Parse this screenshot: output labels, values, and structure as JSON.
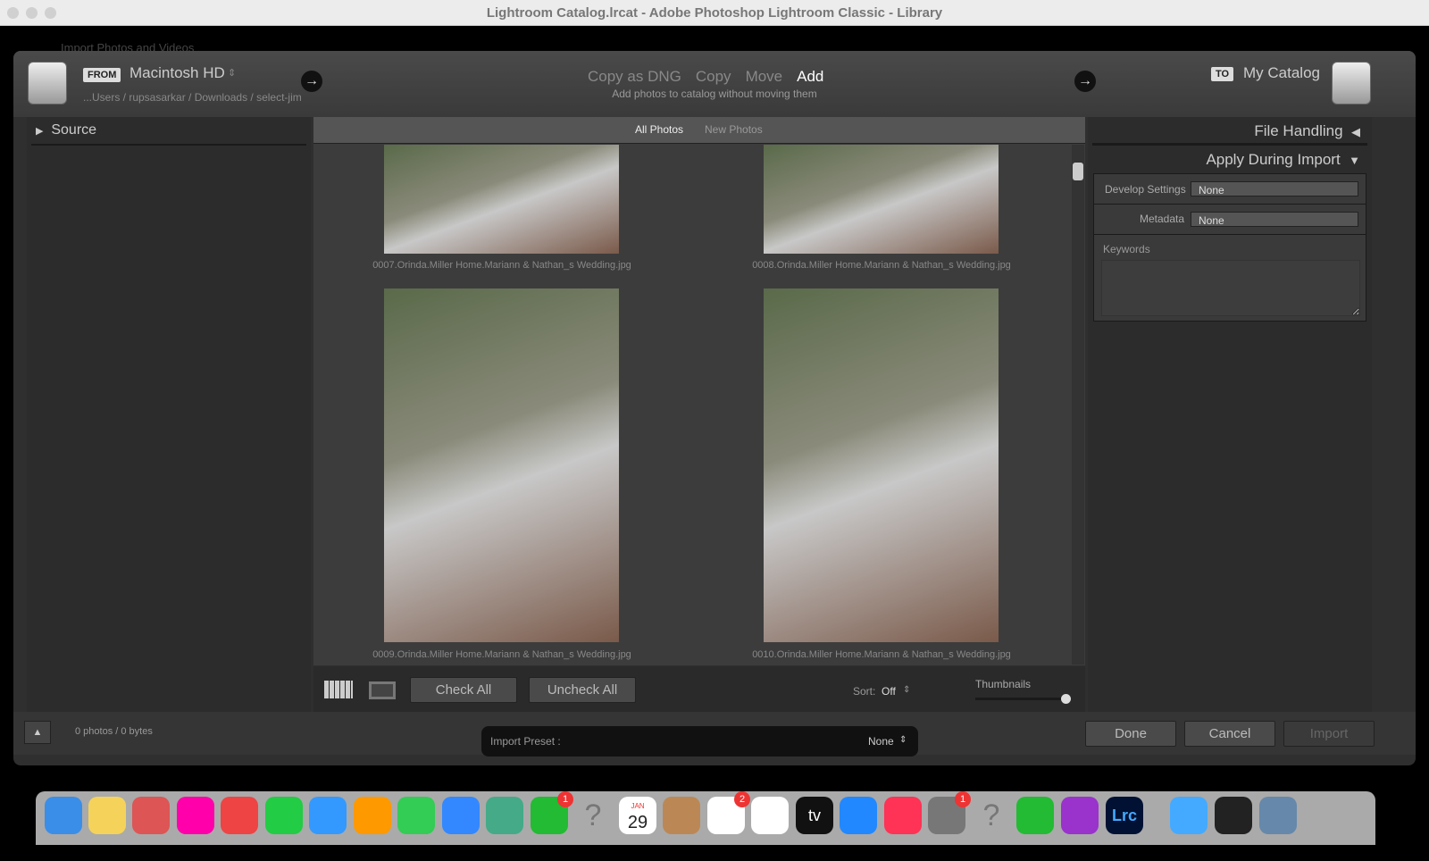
{
  "window": {
    "title": "Lightroom Catalog.lrcat - Adobe Photoshop Lightroom Classic - Library",
    "behind_title": "Import Photos and Videos"
  },
  "header": {
    "from_tag": "FROM",
    "source": "Macintosh HD",
    "source_path": "...Users / rupsasarkar / Downloads / select-jim",
    "modes": [
      "Copy as DNG",
      "Copy",
      "Move",
      "Add"
    ],
    "active_mode": "Add",
    "mode_description": "Add photos to catalog without moving them",
    "to_tag": "TO",
    "destination": "My Catalog"
  },
  "left_panel": {
    "source_label": "Source"
  },
  "grid": {
    "tabs": [
      "All Photos",
      "New Photos"
    ],
    "active_tab": "All Photos",
    "photos": [
      "0007.Orinda.Miller Home.Mariann & Nathan_s Wedding.jpg",
      "0008.Orinda.Miller Home.Mariann & Nathan_s Wedding.jpg",
      "0009.Orinda.Miller Home.Mariann & Nathan_s Wedding.jpg",
      "0010.Orinda.Miller Home.Mariann & Nathan_s Wedding.jpg"
    ]
  },
  "toolbar": {
    "check_all": "Check All",
    "uncheck_all": "Uncheck All",
    "sort_label": "Sort:",
    "sort_value": "Off",
    "thumbnails_label": "Thumbnails",
    "thumbnail_size": 1.0
  },
  "right_panel": {
    "file_handling": "File Handling",
    "apply_during_import": "Apply During Import",
    "develop_settings_label": "Develop Settings",
    "develop_settings_value": "None",
    "metadata_label": "Metadata",
    "metadata_value": "None",
    "keywords_label": "Keywords"
  },
  "footer": {
    "status": "0 photos / 0 bytes",
    "import_preset_label": "Import Preset :",
    "import_preset_value": "None",
    "done": "Done",
    "cancel": "Cancel",
    "import": "Import"
  },
  "dock": {
    "calendar_month": "JAN",
    "calendar_day": "29",
    "facetime_badge": "1",
    "reminders_badge": "2",
    "settings_badge": "1",
    "apps": [
      "Finder",
      "Notes",
      "Launchpad",
      "Photos",
      "Chrome",
      "WhatsApp",
      "Safari",
      "Pages",
      "Messages",
      "Mail",
      "Maps",
      "FaceTime",
      "Unknown",
      "Calendar",
      "Contacts",
      "Reminders",
      "Freeform",
      "TV",
      "App Store",
      "Music",
      "System Settings",
      "Unknown",
      "Numbers",
      "Podcasts",
      "Lightroom Classic",
      "QuickTime",
      "Frame",
      "Preview",
      "Trash"
    ],
    "lrc_label": "Lrc",
    "tv_label": "tv"
  }
}
